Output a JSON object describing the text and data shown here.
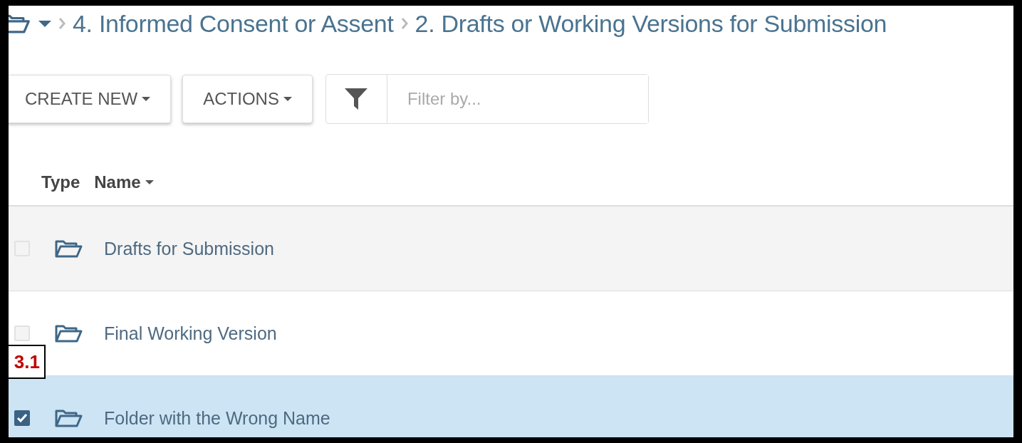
{
  "breadcrumb": {
    "items": [
      {
        "label": "4. Informed Consent or Assent"
      },
      {
        "label": "2. Drafts or Working Versions for Submission"
      }
    ]
  },
  "toolbar": {
    "buttons": [
      {
        "label": "CREATE NEW"
      },
      {
        "label": "ACTIONS"
      }
    ],
    "filter": {
      "placeholder": "Filter by..."
    }
  },
  "table": {
    "columns": [
      {
        "label": "Type",
        "sorted": false
      },
      {
        "label": "Name",
        "sorted": true
      }
    ],
    "rows": [
      {
        "name": "Drafts for Submission",
        "checked": false,
        "selected": false
      },
      {
        "name": "Final Working Version",
        "checked": false,
        "selected": false
      },
      {
        "name": "Folder with the Wrong Name",
        "checked": true,
        "selected": true
      }
    ]
  },
  "callout": {
    "label": "3.1"
  }
}
